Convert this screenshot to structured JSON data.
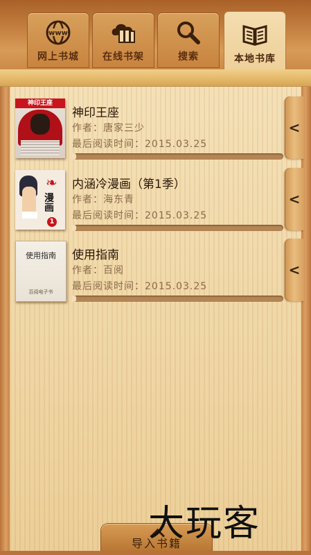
{
  "tabs": [
    {
      "label": "网上书城",
      "icon": "globe-www-icon",
      "active": false
    },
    {
      "label": "在线书架",
      "icon": "cloud-books-icon",
      "active": false
    },
    {
      "label": "搜索",
      "icon": "magnifier-icon",
      "active": false
    },
    {
      "label": "本地书库",
      "icon": "open-book-icon",
      "active": true
    }
  ],
  "books": [
    {
      "title": "神印王座",
      "author": "作者：唐家三少",
      "read_time": "最后阅读时间：2015.03.25",
      "progress": 0.0,
      "cover_text": "神印王座"
    },
    {
      "title": "内涵冷漫画（第1季）",
      "author": "作者：海东青",
      "read_time": "最后阅读时间：2015.03.25",
      "progress": 0.0,
      "cover_text": "漫画",
      "cover_badge": "1"
    },
    {
      "title": "使用指南",
      "author": "作者：百阅",
      "read_time": "最后阅读时间：2015.03.25",
      "progress": 0.0,
      "cover_text": "使用指南",
      "cover_subtext": "百阅电子书"
    }
  ],
  "handle_glyph": "<",
  "import_label": "导入书籍",
  "watermark": "大玩客"
}
